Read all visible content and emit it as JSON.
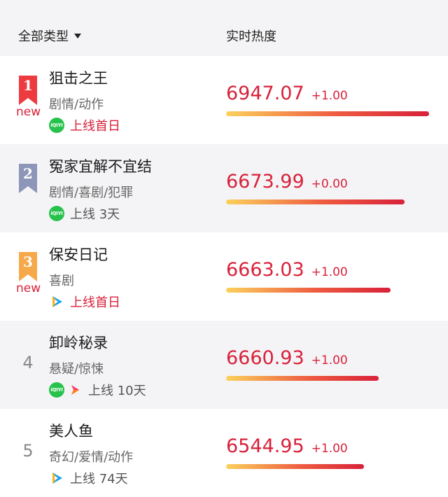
{
  "header": {
    "type_label": "全部类型",
    "heat_label": "实时热度"
  },
  "rows": [
    {
      "rank": "1",
      "badge_color": "#ee3b40",
      "is_new": true,
      "new_label": "new",
      "title": "狙击之王",
      "genre": "剧情/动作",
      "platform_icons": [
        "iqiyi-icon"
      ],
      "online_text": "上线首日",
      "online_color": "red",
      "heat": "6947.07",
      "delta": "+1.00",
      "heat_fraction": 1.0
    },
    {
      "rank": "2",
      "badge_color": "#8d96b8",
      "is_new": false,
      "title": "冤家宜解不宜结",
      "genre": "剧情/喜剧/犯罪",
      "platform_icons": [
        "iqiyi-icon"
      ],
      "online_text": "上线 3天",
      "online_color": "gray",
      "heat": "6673.99",
      "delta": "+0.00",
      "heat_fraction": 0.88
    },
    {
      "rank": "3",
      "badge_color": "#f6a94a",
      "is_new": true,
      "new_label": "new",
      "title": "保安日记",
      "genre": "喜剧",
      "platform_icons": [
        "tencent-video-icon"
      ],
      "online_text": "上线首日",
      "online_color": "red",
      "heat": "6663.03",
      "delta": "+1.00",
      "heat_fraction": 0.81
    },
    {
      "rank": "4",
      "is_new": false,
      "title": "卸岭秘录",
      "genre": "悬疑/惊悚",
      "platform_icons": [
        "iqiyi-icon",
        "mango-tv-icon"
      ],
      "online_text": "上线 10天",
      "online_color": "gray",
      "heat": "6660.93",
      "delta": "+1.00",
      "heat_fraction": 0.75
    },
    {
      "rank": "5",
      "is_new": false,
      "title": "美人鱼",
      "genre": "奇幻/爱情/动作",
      "platform_icons": [
        "tencent-video-icon"
      ],
      "online_text": "上线 74天",
      "online_color": "gray",
      "heat": "6544.95",
      "delta": "+1.00",
      "heat_fraction": 0.68
    }
  ]
}
